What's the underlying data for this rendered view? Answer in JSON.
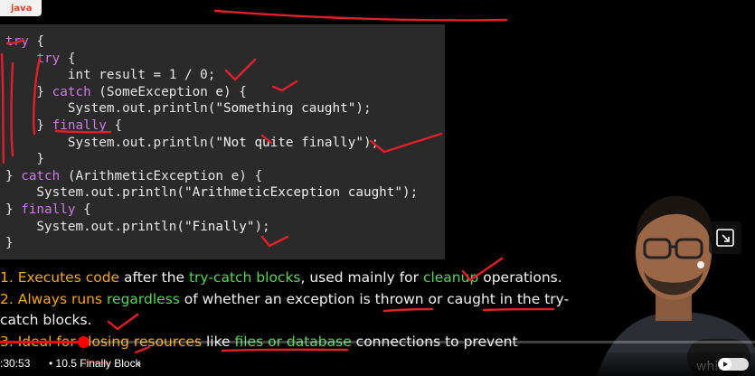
{
  "brand": {
    "logo_text": "java"
  },
  "code": {
    "lines": [
      [
        {
          "t": "try",
          "k": "kw"
        },
        {
          "t": " {"
        }
      ],
      [
        {
          "t": "    "
        },
        {
          "t": "try",
          "k": "kw"
        },
        {
          "t": " {"
        }
      ],
      [
        {
          "t": "        int result = 1 / 0;"
        }
      ],
      [
        {
          "t": "    } "
        },
        {
          "t": "catch",
          "k": "kw"
        },
        {
          "t": " (SomeException e) {"
        }
      ],
      [
        {
          "t": "        System.out.println("
        },
        {
          "t": "\"Something caught\"",
          "k": "str"
        },
        {
          "t": ");"
        }
      ],
      [
        {
          "t": "    } "
        },
        {
          "t": "finally",
          "k": "kw"
        },
        {
          "t": " {"
        }
      ],
      [
        {
          "t": "        System.out.println("
        },
        {
          "t": "\"Not quite finally\"",
          "k": "str"
        },
        {
          "t": ");"
        }
      ],
      [
        {
          "t": "    }"
        }
      ],
      [
        {
          "t": "} "
        },
        {
          "t": "catch",
          "k": "kw"
        },
        {
          "t": " (ArithmeticException e) {"
        }
      ],
      [
        {
          "t": "    System.out.println("
        },
        {
          "t": "\"ArithmeticException caught\"",
          "k": "str"
        },
        {
          "t": ");"
        }
      ],
      [
        {
          "t": "} "
        },
        {
          "t": "finally",
          "k": "kw"
        },
        {
          "t": " {"
        }
      ],
      [
        {
          "t": "    System.out.println("
        },
        {
          "t": "\"Finally\"",
          "k": "str"
        },
        {
          "t": ");"
        }
      ],
      [
        {
          "t": "}"
        }
      ]
    ]
  },
  "bullets": [
    {
      "num": "1.",
      "parts": [
        {
          "t": " Executes code",
          "c": "orange"
        },
        {
          "t": " after the ",
          "c": "white"
        },
        {
          "t": "try-catch blocks",
          "c": "green"
        },
        {
          "t": ", used mainly for ",
          "c": "white"
        },
        {
          "t": "cleanup",
          "c": "green"
        },
        {
          "t": " operations.",
          "c": "white"
        }
      ]
    },
    {
      "num": "2.",
      "parts": [
        {
          "t": " Always runs ",
          "c": "orange"
        },
        {
          "t": "regardless",
          "c": "green"
        },
        {
          "t": " of whether an exception is thrown or caught in the try-",
          "c": "white"
        }
      ]
    },
    {
      "num": "",
      "parts": [
        {
          "t": "   catch blocks.",
          "c": "white"
        }
      ]
    },
    {
      "num": "3.",
      "parts": [
        {
          "t": " Ideal for closing resources",
          "c": "orange"
        },
        {
          "t": " like ",
          "c": "white"
        },
        {
          "t": "files or database",
          "c": "green"
        },
        {
          "t": " connections to prevent",
          "c": "white"
        }
      ]
    }
  ],
  "player": {
    "time": ":30:53",
    "chapter_sep": "•",
    "chapter": "10.5 Finally Block",
    "chevron": "›",
    "progress_fraction": 0.11
  },
  "colors": {
    "ink": "#e3202a",
    "progress": "#ff0000",
    "keyword": "#cc7be0",
    "orange": "#f5a623",
    "green": "#5bd35b"
  },
  "icons": [
    "expand-icon",
    "autoplay-toggle-icon",
    "presenter-photo"
  ]
}
